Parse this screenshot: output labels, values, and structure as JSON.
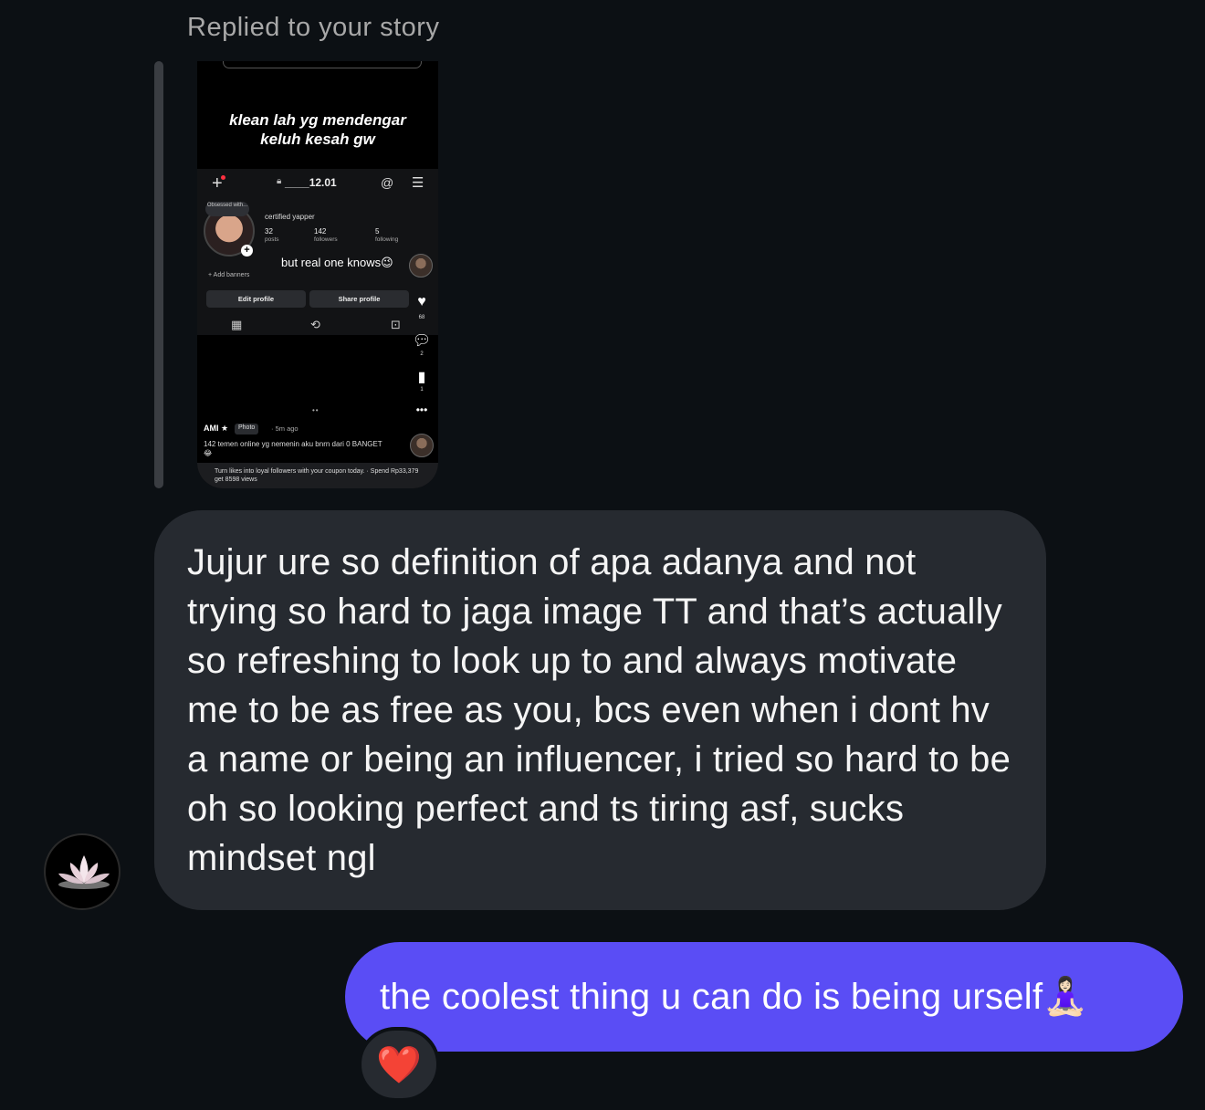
{
  "reply_label": "Replied to your story",
  "story": {
    "overlay_line1": "klean lah yg mendengar",
    "overlay_line2": "keluh kesah gw",
    "profile": {
      "username": "____12.01",
      "note": "Obsessed with...",
      "bio": "certified yapper",
      "posts_count": "32",
      "posts_label": "posts",
      "followers_count": "142",
      "followers_label": "followers",
      "following_count": "5",
      "following_label": "following",
      "add_banners": "+ Add banners",
      "edit_profile": "Edit profile",
      "share_profile": "Share profile"
    },
    "overlay_text": "but real one knows😉",
    "likes": "68",
    "comments": "2",
    "saves": "1",
    "post": {
      "author": "AMI ★",
      "badge": "Photo",
      "time": "· 5m ago",
      "caption": "142 temen online yg nemenin aku bnrn dari 0 BANGET😂",
      "ad": "Turn likes into loyal followers with your coupon today. · Spend Rp33,379 get 8598 views"
    }
  },
  "messages": {
    "incoming": "Jujur ure so definition of apa adanya and not trying so hard to jaga image TT and that’s actually so refreshing to look up to and always motivate me to be as free as you, bcs even when i dont hv a name or being an influencer, i tried so hard to be oh so looking perfect and ts tiring asf, sucks mindset ngl",
    "outgoing": "the coolest thing u can do is being urself🧘🏻‍♀️",
    "reaction": "❤️"
  },
  "colors": {
    "background": "#0c1014",
    "incoming_bubble": "#262a30",
    "outgoing_bubble": "#5a4df5"
  }
}
